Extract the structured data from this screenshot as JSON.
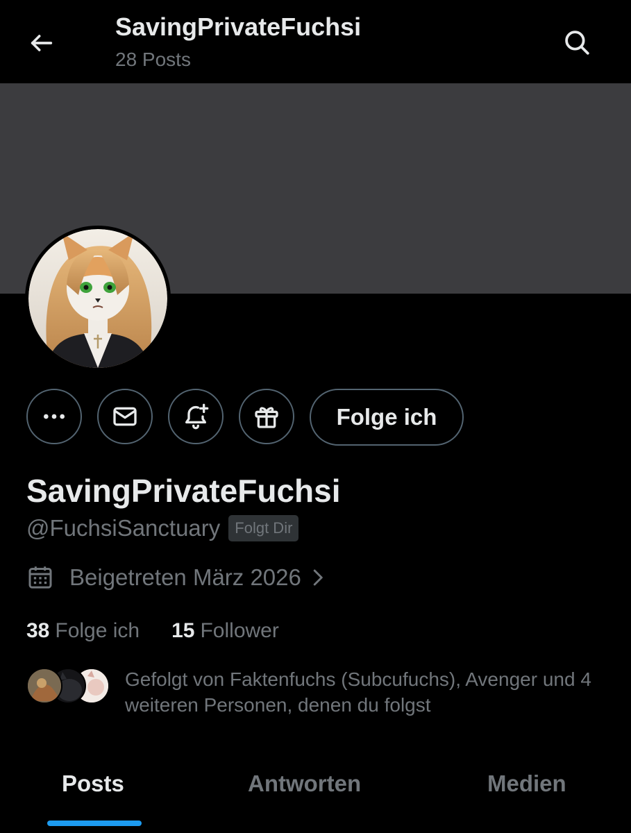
{
  "header": {
    "title": "SavingPrivateFuchsi",
    "posts_count": "28 Posts",
    "back_icon": "arrow-left-icon",
    "search_icon": "search-icon"
  },
  "banner": {
    "color": "#3c3c3f"
  },
  "profile": {
    "display_name": "SavingPrivateFuchsi",
    "handle": "@FuchsiSanctuary",
    "follows_you_badge": "Folgt Dir",
    "joined": "Beigetreten März 2026",
    "follow_button": "Folge ich"
  },
  "actions": [
    {
      "name": "more",
      "icon": "more-dots-icon"
    },
    {
      "name": "message",
      "icon": "envelope-icon"
    },
    {
      "name": "notify",
      "icon": "bell-plus-icon"
    },
    {
      "name": "gift",
      "icon": "gift-icon"
    }
  ],
  "stats": {
    "following_count": "38",
    "following_label": "Folge ich",
    "followers_count": "15",
    "followers_label": "Follower"
  },
  "followed_by": {
    "text": "Gefolgt von Faktenfuchs (Subcufuchs), Avenger und 4 weiteren Personen, denen du folgst"
  },
  "tabs": [
    {
      "label": "Posts",
      "active": true
    },
    {
      "label": "Antworten",
      "active": false
    },
    {
      "label": "Medien",
      "active": false
    }
  ],
  "colors": {
    "background": "#000000",
    "text_primary": "#e7e9ea",
    "text_secondary": "#71767b",
    "accent": "#1d9bf0"
  }
}
